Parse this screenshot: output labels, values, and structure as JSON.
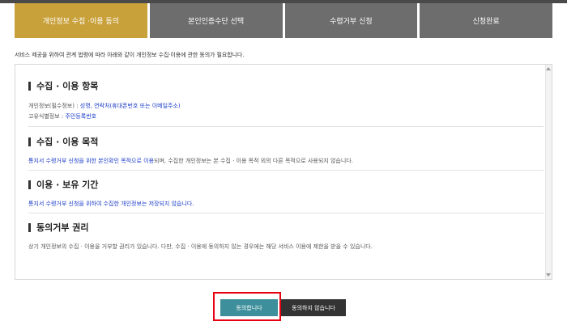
{
  "steps": [
    {
      "label": "개인정보 수집 ·이용 동의",
      "active": true
    },
    {
      "label": "본인인증수단 선택",
      "active": false
    },
    {
      "label": "수령거부 신청",
      "active": false
    },
    {
      "label": "신청완료",
      "active": false
    }
  ],
  "intro": "서비스 제공을 위하여 관계 법령에 따라 아래와 같이 개인정보 수집·이용에 관한 동의가 필요합니다.",
  "sections": {
    "items": {
      "title": "수집 · 이용 항목",
      "personal_label": "개인정보(필수정보) : ",
      "personal_value": "성명, 연락처(휴대폰번호 또는 이메일주소)",
      "unique_label": "고유식별정보 : ",
      "unique_value": "주민등록번호"
    },
    "purpose": {
      "title": "수집 · 이용 목적",
      "blue_text": "통지서 수령거부 신청을 위한 본인확인 목적으로 이용",
      "rest_text": "되며, 수집한 개인정보는 본 수집 · 이용 목적 외의 다른 목적으로 사용되지 않습니다."
    },
    "retention": {
      "title": "이용 · 보유 기간",
      "text": "통지서 수령거부 신청을 위하여 수집한 개인정보는 저장되지 않습니다."
    },
    "refusal": {
      "title": "동의거부 권리",
      "text": "상기 개인정보의 수집 · 이용을 거부할 권리가 있습니다.  다만,  수집 · 이용에 동의하지 않는 경우에는 해당 서비스 이용에 제한을 받을 수 있습니다."
    }
  },
  "buttons": {
    "agree": "동의합니다",
    "disagree": "동의하지 않습니다"
  },
  "colors": {
    "active_step": "#c9a13b",
    "inactive_step": "#6d6d6d",
    "agree_button": "#3d8f9b",
    "highlight_border": "#e60012",
    "link_blue": "#1a3cc8"
  }
}
